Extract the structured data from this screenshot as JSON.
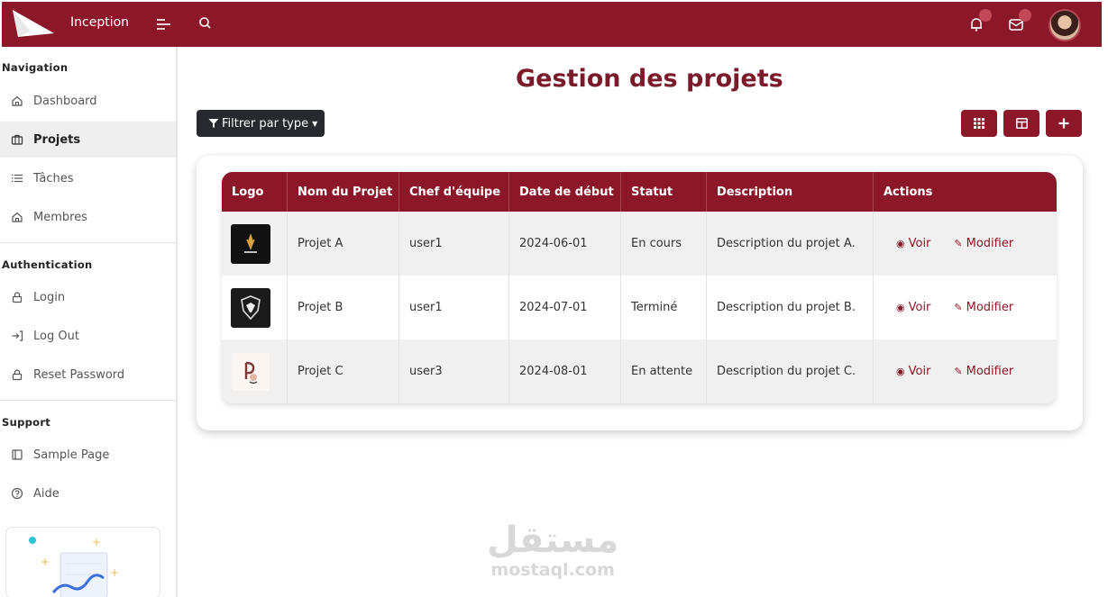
{
  "topbar": {
    "brand": "Inception",
    "icons": [
      "menu-toggle-icon",
      "search-icon",
      "bell-icon",
      "mail-icon"
    ],
    "accent": "#8b1728"
  },
  "sidebar": {
    "sections": [
      {
        "title": "Navigation",
        "items": [
          {
            "label": "Dashboard",
            "icon": "home-icon"
          },
          {
            "label": "Projets",
            "icon": "briefcase-icon",
            "active": true
          },
          {
            "label": "Tâches",
            "icon": "list-icon"
          },
          {
            "label": "Membres",
            "icon": "home-icon"
          }
        ]
      },
      {
        "title": "Authentication",
        "items": [
          {
            "label": "Login",
            "icon": "lock-icon"
          },
          {
            "label": "Log Out",
            "icon": "logout-icon"
          },
          {
            "label": "Reset Password",
            "icon": "lock-icon"
          }
        ]
      },
      {
        "title": "Support",
        "items": [
          {
            "label": "Sample Page",
            "icon": "page-icon"
          },
          {
            "label": "Aide",
            "icon": "help-icon"
          }
        ]
      }
    ]
  },
  "main": {
    "title": "Gestion des projets",
    "filter_label": "Filtrer par type",
    "toolbar": [
      "grid-view-icon",
      "table-view-icon",
      "plus-icon"
    ],
    "table": {
      "headers": [
        "Logo",
        "Nom du Projet",
        "Chef d'équipe",
        "Date de début",
        "Statut",
        "Description",
        "Actions"
      ],
      "rows": [
        {
          "name": "Projet A",
          "chef": "user1",
          "date": "2024-06-01",
          "status": "En cours",
          "description": "Description du projet A."
        },
        {
          "name": "Projet B",
          "chef": "user1",
          "date": "2024-07-01",
          "status": "Terminé",
          "description": "Description du projet B."
        },
        {
          "name": "Projet C",
          "chef": "user3",
          "date": "2024-08-01",
          "status": "En attente",
          "description": "Description du projet C."
        }
      ],
      "action_view": "Voir",
      "action_edit": "Modifier"
    }
  },
  "watermark": {
    "arabic": "مستقل",
    "latin": "mostaql.com"
  }
}
